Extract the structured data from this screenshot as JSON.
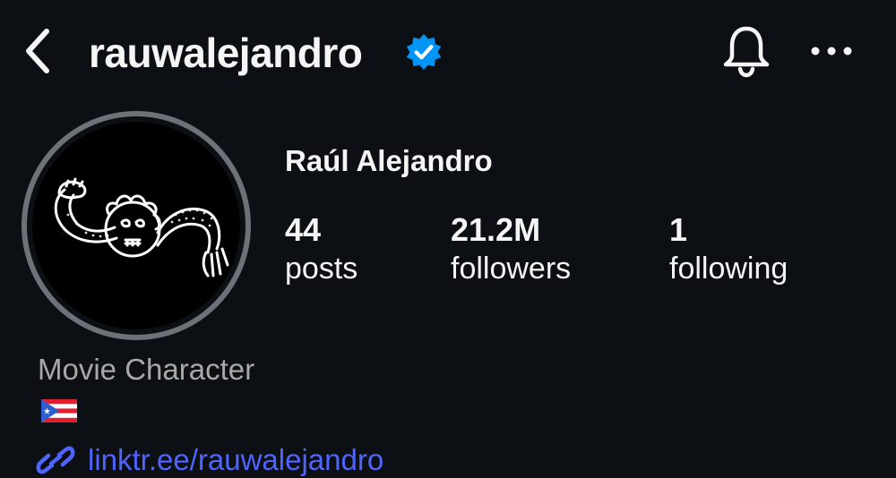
{
  "header": {
    "username": "rauwalejandro",
    "verified": true,
    "icons": [
      "back-chevron-icon",
      "verified-badge-icon",
      "bell-icon",
      "more-icon"
    ]
  },
  "profile": {
    "full_name": "Raúl Alejandro",
    "stats": [
      {
        "value": "44",
        "label": "posts"
      },
      {
        "value": "21.2M",
        "label": "followers"
      },
      {
        "value": "1",
        "label": "following"
      }
    ],
    "category": "Movie Character",
    "bio_flag": "puerto-rico-flag-icon",
    "link": "linktr.ee/rauwalejandro"
  },
  "colors": {
    "background": "#0c1014",
    "text": "#f5f5f5",
    "muted": "#a8a8a8",
    "verified": "#0095f6",
    "link": "#4f63ff",
    "avatar_ring": "#6c7278"
  }
}
